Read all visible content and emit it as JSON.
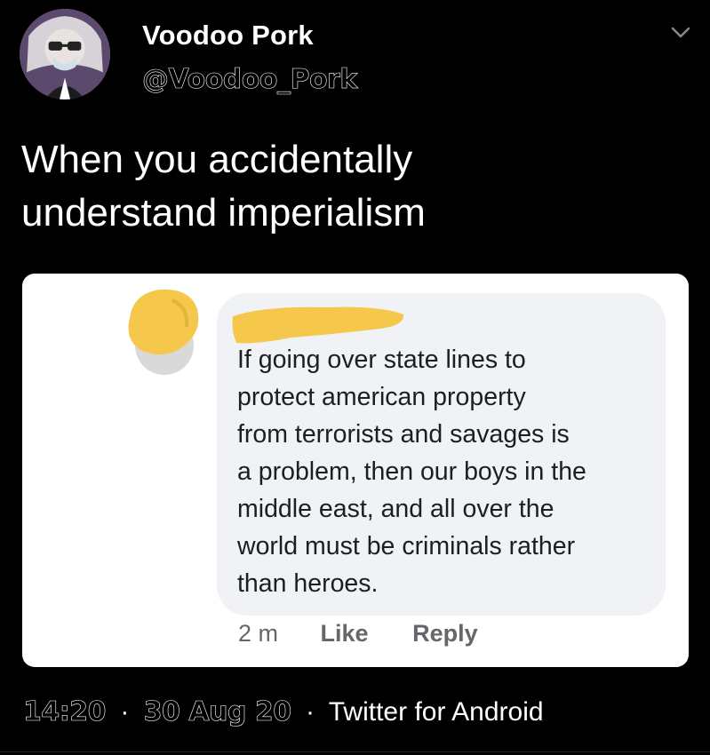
{
  "author": {
    "display_name": "Voodoo Pork",
    "handle": "@Voodoo_Pork",
    "avatar_icon": "profile-avatar"
  },
  "menu_icon": "chevron-down-icon",
  "tweet": {
    "text_line1": "When you accidentally",
    "text_line2": "understand imperialism"
  },
  "embedded_comment": {
    "name_redacted": true,
    "redaction_color": "#f5c84c",
    "lines": [
      "If going over state lines to",
      "protect american property",
      "from terrorists and savages is",
      "a problem, then our boys in the",
      "middle east, and all over the",
      "world must be criminals rather",
      "than heroes."
    ],
    "time_ago": "2 m",
    "like_label": "Like",
    "reply_label": "Reply"
  },
  "footer": {
    "time": "14:20",
    "separator": "·",
    "date": "30 Aug 20",
    "source": "Twitter for Android"
  },
  "colors": {
    "background": "#000000",
    "text": "#ffffff",
    "card": "#ffffff",
    "bubble": "#f0f2f5",
    "comment_text": "#1c1e21",
    "action_text": "#65676b"
  }
}
